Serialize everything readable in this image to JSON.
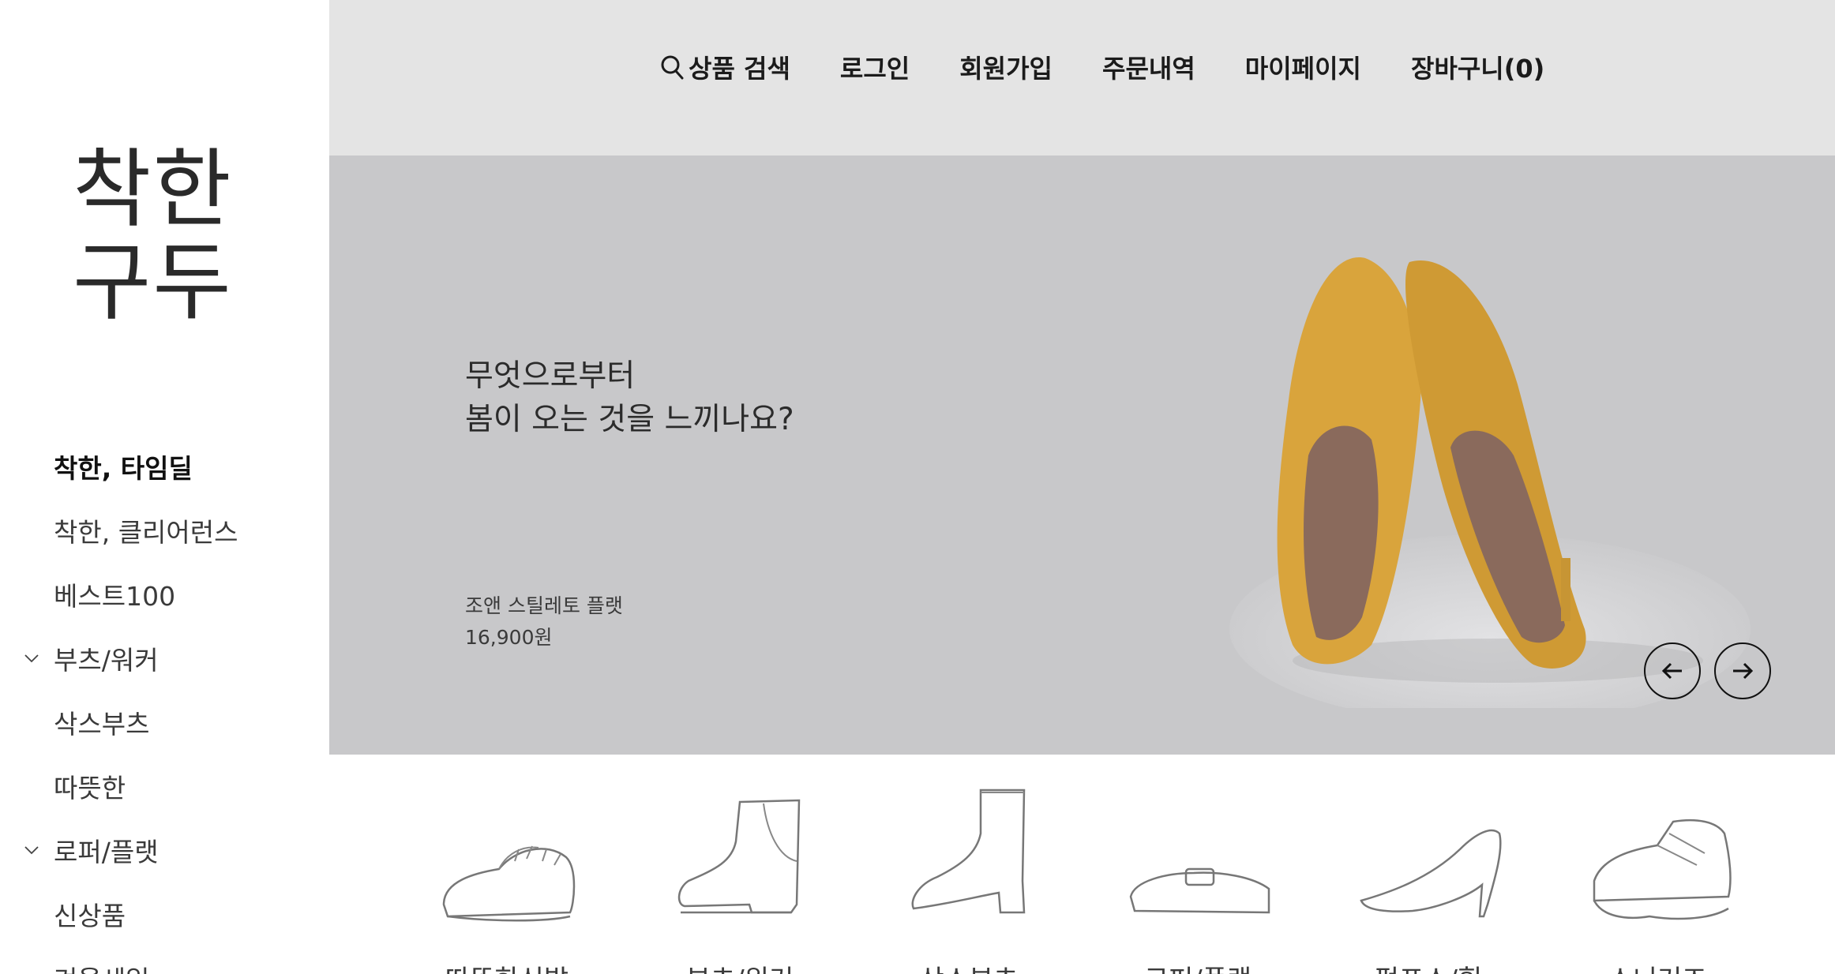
{
  "sidebar": {
    "logo_line1": "착한",
    "logo_line2": "구두",
    "items": [
      {
        "label": "착한, 타임딜"
      },
      {
        "label": "착한, 클리어런스"
      },
      {
        "label": "베스트100"
      },
      {
        "label": "부츠/워커"
      },
      {
        "label": "삭스부츠"
      },
      {
        "label": "따뜻한"
      },
      {
        "label": "로퍼/플랫"
      },
      {
        "label": "신상품"
      },
      {
        "label": "겨울세일"
      }
    ]
  },
  "header": {
    "search": "상품 검색",
    "login": "로그인",
    "signup": "회원가입",
    "orders": "주문내역",
    "mypage": "마이페이지",
    "cart": "장바구니(0)"
  },
  "banner": {
    "headline_line1": "무엇으로부터",
    "headline_line2": "봄이 오는 것을 느끼나요?",
    "product_name": "조앤 스틸레토 플랫",
    "product_price": "16,900원",
    "shoe_color": "#d9a43c"
  },
  "categories": [
    {
      "label": "따뜻한신발"
    },
    {
      "label": "부츠/워커"
    },
    {
      "label": "삭스부츠"
    },
    {
      "label": "로퍼/플랫"
    },
    {
      "label": "펌프스/힐"
    },
    {
      "label": "스니커즈"
    }
  ]
}
